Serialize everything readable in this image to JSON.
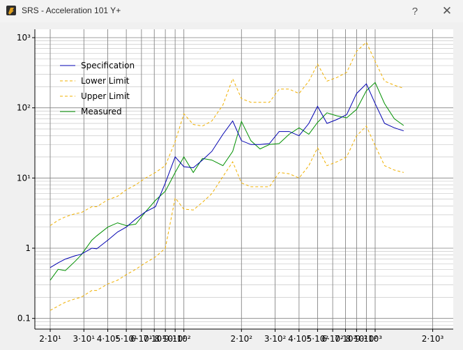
{
  "window": {
    "title": "SRS - Acceleration 101 Y+",
    "help_label": "?",
    "close_label": "✕",
    "app_icon": "srs-app-icon"
  },
  "colors": {
    "specification": "#0000b0",
    "limits": "#f0b000",
    "measured": "#009000",
    "grid_major": "#808080",
    "grid_minor": "#c8c8c8"
  },
  "chart_data": {
    "type": "line",
    "x_scale": "log",
    "y_scale": "log",
    "xlim": [
      17,
      1100
    ],
    "ylim": [
      0.09,
      1200
    ],
    "legend_position": "top-left",
    "grid": true,
    "x_tick_labels": [
      {
        "x": 20,
        "label": "2·10¹"
      },
      {
        "x": 30,
        "label": "3·10¹"
      },
      {
        "x": 40,
        "label": "4·10¹"
      },
      {
        "x": 50,
        "label": "5·10¹"
      },
      {
        "x": 60,
        "label": "6·10¹"
      },
      {
        "x": 70,
        "label": "7·10¹"
      },
      {
        "x": 80,
        "label": "8·10¹"
      },
      {
        "x": 90,
        "label": "9·10¹"
      },
      {
        "x": 100,
        "label": "10²"
      },
      {
        "x": 200,
        "label": "2·10²"
      },
      {
        "x": 300,
        "label": "3·10²"
      },
      {
        "x": 400,
        "label": "4·10²"
      },
      {
        "x": 500,
        "label": "5·10²"
      },
      {
        "x": 600,
        "label": "6·10²"
      },
      {
        "x": 700,
        "label": "7·10²"
      },
      {
        "x": 800,
        "label": "8·10²"
      },
      {
        "x": 900,
        "label": "9·10²"
      },
      {
        "x": 1000,
        "label": "10³"
      },
      {
        "x": 2000,
        "label": "2·10³"
      }
    ],
    "y_tick_labels": [
      {
        "y": 0.1,
        "label": "0.1"
      },
      {
        "y": 1,
        "label": "1"
      },
      {
        "y": 10,
        "label": "10¹"
      },
      {
        "y": 100,
        "label": "10²"
      },
      {
        "y": 1000,
        "label": "10³"
      }
    ],
    "series": [
      {
        "name": "Specification",
        "style": "solid",
        "points": [
          [
            20,
            0.53
          ],
          [
            22,
            0.62
          ],
          [
            24,
            0.7
          ],
          [
            27,
            0.78
          ],
          [
            29,
            0.82
          ],
          [
            33,
            1.0
          ],
          [
            35,
            0.98
          ],
          [
            40,
            1.3
          ],
          [
            45,
            1.7
          ],
          [
            50,
            2.0
          ],
          [
            56,
            2.6
          ],
          [
            63,
            3.3
          ],
          [
            71,
            3.9
          ],
          [
            80,
            8.5
          ],
          [
            90,
            20
          ],
          [
            100,
            14.5
          ],
          [
            112,
            14
          ],
          [
            125,
            18
          ],
          [
            140,
            24
          ],
          [
            160,
            42
          ],
          [
            180,
            65
          ],
          [
            200,
            34
          ],
          [
            224,
            30
          ],
          [
            250,
            30
          ],
          [
            280,
            31
          ],
          [
            315,
            46
          ],
          [
            355,
            46
          ],
          [
            400,
            40
          ],
          [
            450,
            60
          ],
          [
            500,
            105
          ],
          [
            560,
            60
          ],
          [
            630,
            68
          ],
          [
            710,
            80
          ],
          [
            800,
            160
          ],
          [
            900,
            220
          ],
          [
            1000,
            115
          ],
          [
            1120,
            60
          ],
          [
            1260,
            52
          ],
          [
            1410,
            47
          ]
        ]
      },
      {
        "name": "Lower Limit",
        "style": "dashed",
        "points": [
          [
            20,
            0.13
          ],
          [
            22,
            0.15
          ],
          [
            24,
            0.17
          ],
          [
            27,
            0.19
          ],
          [
            29,
            0.2
          ],
          [
            33,
            0.25
          ],
          [
            35,
            0.25
          ],
          [
            40,
            0.31
          ],
          [
            45,
            0.35
          ],
          [
            50,
            0.42
          ],
          [
            56,
            0.5
          ],
          [
            63,
            0.62
          ],
          [
            71,
            0.75
          ],
          [
            80,
            1.0
          ],
          [
            90,
            5.2
          ],
          [
            100,
            3.6
          ],
          [
            112,
            3.5
          ],
          [
            125,
            4.5
          ],
          [
            140,
            6.0
          ],
          [
            160,
            10.5
          ],
          [
            180,
            17
          ],
          [
            200,
            8.5
          ],
          [
            224,
            7.5
          ],
          [
            250,
            7.5
          ],
          [
            280,
            7.5
          ],
          [
            315,
            12
          ],
          [
            355,
            11.5
          ],
          [
            400,
            10
          ],
          [
            450,
            15
          ],
          [
            500,
            27
          ],
          [
            560,
            15
          ],
          [
            630,
            17
          ],
          [
            710,
            20
          ],
          [
            800,
            40
          ],
          [
            900,
            55
          ],
          [
            1000,
            29
          ],
          [
            1120,
            15
          ],
          [
            1260,
            13
          ],
          [
            1410,
            12
          ]
        ]
      },
      {
        "name": "Upper Limit",
        "style": "dashed",
        "points": [
          [
            20,
            2.1
          ],
          [
            22,
            2.5
          ],
          [
            24,
            2.8
          ],
          [
            27,
            3.1
          ],
          [
            29,
            3.2
          ],
          [
            33,
            3.9
          ],
          [
            35,
            3.9
          ],
          [
            40,
            4.9
          ],
          [
            45,
            5.5
          ],
          [
            50,
            6.8
          ],
          [
            56,
            8.0
          ],
          [
            63,
            10.0
          ],
          [
            71,
            12
          ],
          [
            80,
            15
          ],
          [
            90,
            33
          ],
          [
            100,
            82
          ],
          [
            112,
            58
          ],
          [
            125,
            55
          ],
          [
            140,
            65
          ],
          [
            160,
            110
          ],
          [
            180,
            260
          ],
          [
            200,
            135
          ],
          [
            224,
            120
          ],
          [
            250,
            120
          ],
          [
            280,
            120
          ],
          [
            315,
            185
          ],
          [
            355,
            185
          ],
          [
            400,
            160
          ],
          [
            450,
            240
          ],
          [
            500,
            420
          ],
          [
            560,
            240
          ],
          [
            630,
            270
          ],
          [
            710,
            320
          ],
          [
            800,
            640
          ],
          [
            900,
            860
          ],
          [
            1000,
            460
          ],
          [
            1120,
            240
          ],
          [
            1260,
            210
          ],
          [
            1410,
            190
          ]
        ]
      },
      {
        "name": "Measured",
        "style": "solid",
        "points": [
          [
            20,
            0.35
          ],
          [
            22,
            0.5
          ],
          [
            24,
            0.48
          ],
          [
            27,
            0.65
          ],
          [
            29,
            0.8
          ],
          [
            33,
            1.3
          ],
          [
            35,
            1.5
          ],
          [
            40,
            2.0
          ],
          [
            45,
            2.3
          ],
          [
            50,
            2.1
          ],
          [
            56,
            2.2
          ],
          [
            63,
            3.3
          ],
          [
            71,
            4.8
          ],
          [
            80,
            6.5
          ],
          [
            90,
            12
          ],
          [
            100,
            20
          ],
          [
            112,
            12
          ],
          [
            125,
            19
          ],
          [
            140,
            18
          ],
          [
            160,
            15
          ],
          [
            180,
            24
          ],
          [
            200,
            64
          ],
          [
            224,
            34
          ],
          [
            250,
            26
          ],
          [
            280,
            30
          ],
          [
            315,
            31
          ],
          [
            355,
            42
          ],
          [
            400,
            52
          ],
          [
            450,
            42
          ],
          [
            500,
            62
          ],
          [
            560,
            85
          ],
          [
            630,
            77
          ],
          [
            710,
            72
          ],
          [
            800,
            95
          ],
          [
            900,
            175
          ],
          [
            1000,
            230
          ],
          [
            1120,
            115
          ],
          [
            1260,
            70
          ],
          [
            1410,
            56
          ]
        ]
      }
    ]
  }
}
